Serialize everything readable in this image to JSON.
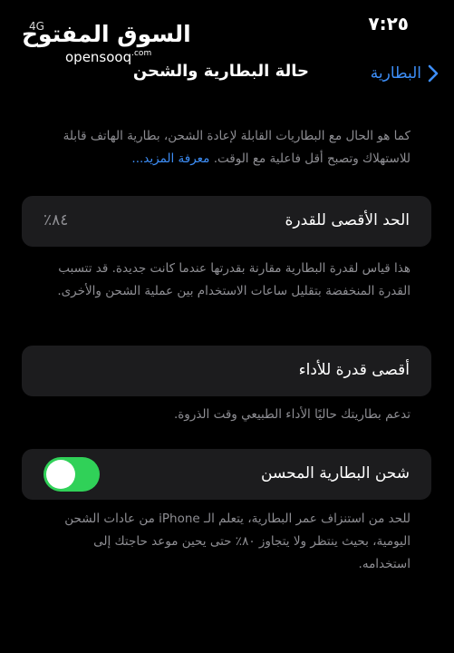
{
  "status_bar": {
    "time": "٧:٢٥",
    "network": "4G"
  },
  "watermark": {
    "arabic": "السوق المفتوح",
    "latin": "opensooq",
    "suffix": ".com"
  },
  "nav": {
    "back_label": "البطارية",
    "title": "حالة البطارية والشحن"
  },
  "intro": {
    "text": "كما هو الحال مع البطاريات القابلة لإعادة الشحن، بطارية الهاتف قابلة للاستهلاك وتصبح أقل فاعلية مع الوقت.",
    "link": "معرفة المزيد..."
  },
  "max_capacity": {
    "label": "الحد الأقصى للقدرة",
    "value": "٨٤٪",
    "description": "هذا قياس لقدرة البطارية مقارنة بقدرتها عندما كانت جديدة. قد تتسبب القدرة المنخفضة بتقليل ساعات الاستخدام بين عملية الشحن والأخرى."
  },
  "peak_performance": {
    "label": "أقصى قدرة للأداء",
    "description": "تدعم بطاريتك حاليًا الأداء الطبيعي وقت الذروة."
  },
  "optimized_charging": {
    "label": "شحن البطارية المحسن",
    "enabled": true,
    "description": "للحد من استنزاف عمر البطارية، يتعلم الـ iPhone من عادات الشحن اليومية، بحيث ينتظر ولا يتجاوز ٨٠٪ حتى يحين موعد حاجتك إلى استخدامه."
  },
  "colors": {
    "background": "#000000",
    "card": "#1c1c1e",
    "accent": "#3d8ef7",
    "toggle_on": "#30d158",
    "secondary_text": "#8e8e93"
  }
}
